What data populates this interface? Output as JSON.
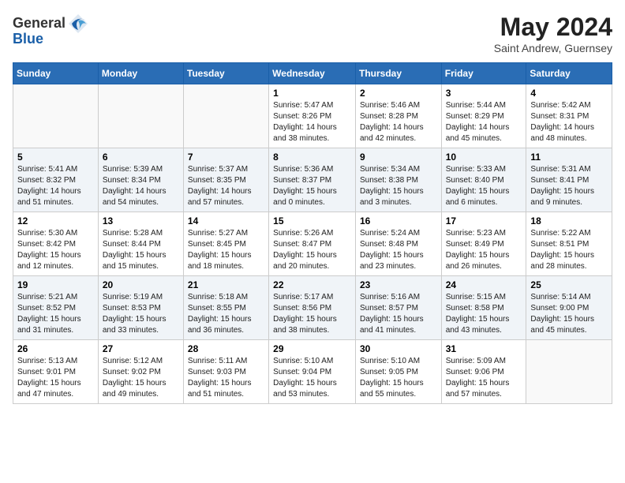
{
  "header": {
    "logo_general": "General",
    "logo_blue": "Blue",
    "month": "May 2024",
    "location": "Saint Andrew, Guernsey"
  },
  "weekdays": [
    "Sunday",
    "Monday",
    "Tuesday",
    "Wednesday",
    "Thursday",
    "Friday",
    "Saturday"
  ],
  "weeks": [
    [
      {
        "day": "",
        "sunrise": "",
        "sunset": "",
        "daylight": ""
      },
      {
        "day": "",
        "sunrise": "",
        "sunset": "",
        "daylight": ""
      },
      {
        "day": "",
        "sunrise": "",
        "sunset": "",
        "daylight": ""
      },
      {
        "day": "1",
        "sunrise": "Sunrise: 5:47 AM",
        "sunset": "Sunset: 8:26 PM",
        "daylight": "Daylight: 14 hours and 38 minutes."
      },
      {
        "day": "2",
        "sunrise": "Sunrise: 5:46 AM",
        "sunset": "Sunset: 8:28 PM",
        "daylight": "Daylight: 14 hours and 42 minutes."
      },
      {
        "day": "3",
        "sunrise": "Sunrise: 5:44 AM",
        "sunset": "Sunset: 8:29 PM",
        "daylight": "Daylight: 14 hours and 45 minutes."
      },
      {
        "day": "4",
        "sunrise": "Sunrise: 5:42 AM",
        "sunset": "Sunset: 8:31 PM",
        "daylight": "Daylight: 14 hours and 48 minutes."
      }
    ],
    [
      {
        "day": "5",
        "sunrise": "Sunrise: 5:41 AM",
        "sunset": "Sunset: 8:32 PM",
        "daylight": "Daylight: 14 hours and 51 minutes."
      },
      {
        "day": "6",
        "sunrise": "Sunrise: 5:39 AM",
        "sunset": "Sunset: 8:34 PM",
        "daylight": "Daylight: 14 hours and 54 minutes."
      },
      {
        "day": "7",
        "sunrise": "Sunrise: 5:37 AM",
        "sunset": "Sunset: 8:35 PM",
        "daylight": "Daylight: 14 hours and 57 minutes."
      },
      {
        "day": "8",
        "sunrise": "Sunrise: 5:36 AM",
        "sunset": "Sunset: 8:37 PM",
        "daylight": "Daylight: 15 hours and 0 minutes."
      },
      {
        "day": "9",
        "sunrise": "Sunrise: 5:34 AM",
        "sunset": "Sunset: 8:38 PM",
        "daylight": "Daylight: 15 hours and 3 minutes."
      },
      {
        "day": "10",
        "sunrise": "Sunrise: 5:33 AM",
        "sunset": "Sunset: 8:40 PM",
        "daylight": "Daylight: 15 hours and 6 minutes."
      },
      {
        "day": "11",
        "sunrise": "Sunrise: 5:31 AM",
        "sunset": "Sunset: 8:41 PM",
        "daylight": "Daylight: 15 hours and 9 minutes."
      }
    ],
    [
      {
        "day": "12",
        "sunrise": "Sunrise: 5:30 AM",
        "sunset": "Sunset: 8:42 PM",
        "daylight": "Daylight: 15 hours and 12 minutes."
      },
      {
        "day": "13",
        "sunrise": "Sunrise: 5:28 AM",
        "sunset": "Sunset: 8:44 PM",
        "daylight": "Daylight: 15 hours and 15 minutes."
      },
      {
        "day": "14",
        "sunrise": "Sunrise: 5:27 AM",
        "sunset": "Sunset: 8:45 PM",
        "daylight": "Daylight: 15 hours and 18 minutes."
      },
      {
        "day": "15",
        "sunrise": "Sunrise: 5:26 AM",
        "sunset": "Sunset: 8:47 PM",
        "daylight": "Daylight: 15 hours and 20 minutes."
      },
      {
        "day": "16",
        "sunrise": "Sunrise: 5:24 AM",
        "sunset": "Sunset: 8:48 PM",
        "daylight": "Daylight: 15 hours and 23 minutes."
      },
      {
        "day": "17",
        "sunrise": "Sunrise: 5:23 AM",
        "sunset": "Sunset: 8:49 PM",
        "daylight": "Daylight: 15 hours and 26 minutes."
      },
      {
        "day": "18",
        "sunrise": "Sunrise: 5:22 AM",
        "sunset": "Sunset: 8:51 PM",
        "daylight": "Daylight: 15 hours and 28 minutes."
      }
    ],
    [
      {
        "day": "19",
        "sunrise": "Sunrise: 5:21 AM",
        "sunset": "Sunset: 8:52 PM",
        "daylight": "Daylight: 15 hours and 31 minutes."
      },
      {
        "day": "20",
        "sunrise": "Sunrise: 5:19 AM",
        "sunset": "Sunset: 8:53 PM",
        "daylight": "Daylight: 15 hours and 33 minutes."
      },
      {
        "day": "21",
        "sunrise": "Sunrise: 5:18 AM",
        "sunset": "Sunset: 8:55 PM",
        "daylight": "Daylight: 15 hours and 36 minutes."
      },
      {
        "day": "22",
        "sunrise": "Sunrise: 5:17 AM",
        "sunset": "Sunset: 8:56 PM",
        "daylight": "Daylight: 15 hours and 38 minutes."
      },
      {
        "day": "23",
        "sunrise": "Sunrise: 5:16 AM",
        "sunset": "Sunset: 8:57 PM",
        "daylight": "Daylight: 15 hours and 41 minutes."
      },
      {
        "day": "24",
        "sunrise": "Sunrise: 5:15 AM",
        "sunset": "Sunset: 8:58 PM",
        "daylight": "Daylight: 15 hours and 43 minutes."
      },
      {
        "day": "25",
        "sunrise": "Sunrise: 5:14 AM",
        "sunset": "Sunset: 9:00 PM",
        "daylight": "Daylight: 15 hours and 45 minutes."
      }
    ],
    [
      {
        "day": "26",
        "sunrise": "Sunrise: 5:13 AM",
        "sunset": "Sunset: 9:01 PM",
        "daylight": "Daylight: 15 hours and 47 minutes."
      },
      {
        "day": "27",
        "sunrise": "Sunrise: 5:12 AM",
        "sunset": "Sunset: 9:02 PM",
        "daylight": "Daylight: 15 hours and 49 minutes."
      },
      {
        "day": "28",
        "sunrise": "Sunrise: 5:11 AM",
        "sunset": "Sunset: 9:03 PM",
        "daylight": "Daylight: 15 hours and 51 minutes."
      },
      {
        "day": "29",
        "sunrise": "Sunrise: 5:10 AM",
        "sunset": "Sunset: 9:04 PM",
        "daylight": "Daylight: 15 hours and 53 minutes."
      },
      {
        "day": "30",
        "sunrise": "Sunrise: 5:10 AM",
        "sunset": "Sunset: 9:05 PM",
        "daylight": "Daylight: 15 hours and 55 minutes."
      },
      {
        "day": "31",
        "sunrise": "Sunrise: 5:09 AM",
        "sunset": "Sunset: 9:06 PM",
        "daylight": "Daylight: 15 hours and 57 minutes."
      },
      {
        "day": "",
        "sunrise": "",
        "sunset": "",
        "daylight": ""
      }
    ]
  ]
}
